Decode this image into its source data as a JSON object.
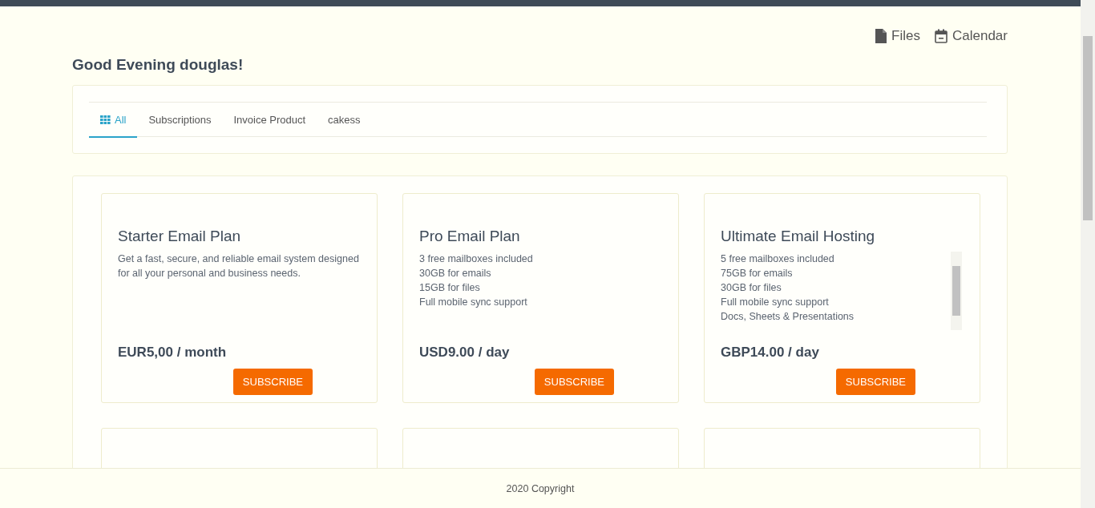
{
  "top_links": [
    {
      "kind": "files",
      "label": "Files"
    },
    {
      "kind": "calendar",
      "label": "Calendar"
    }
  ],
  "greeting": "Good Evening douglas!",
  "tabs": [
    {
      "label": "All",
      "icon": true,
      "selected": true
    },
    {
      "label": "Subscriptions",
      "icon": false,
      "selected": false
    },
    {
      "label": "Invoice Product",
      "icon": false,
      "selected": false
    },
    {
      "label": "cakess",
      "icon": false,
      "selected": false
    }
  ],
  "plans": [
    {
      "title": "Starter Email Plan",
      "kind": "description",
      "description": "Get a fast, secure, and reliable email system designed for all your personal and business needs.",
      "price": "EUR5,00 / month",
      "button": "SUBSCRIBE"
    },
    {
      "title": "Pro Email Plan",
      "kind": "features",
      "features": [
        "3 free mailboxes included",
        "30GB for emails",
        "15GB for files",
        "Full mobile sync support"
      ],
      "price": "USD9.00 / day",
      "button": "SUBSCRIBE"
    },
    {
      "title": "Ultimate Email Hosting",
      "kind": "features",
      "features": [
        "5 free mailboxes included",
        "75GB for emails",
        "30GB for files",
        "Full mobile sync support",
        "Docs, Sheets & Presentations"
      ],
      "scrollable": true,
      "price": "GBP14.00 / day",
      "button": "SUBSCRIBE"
    }
  ],
  "footer": "2020 Copyright"
}
